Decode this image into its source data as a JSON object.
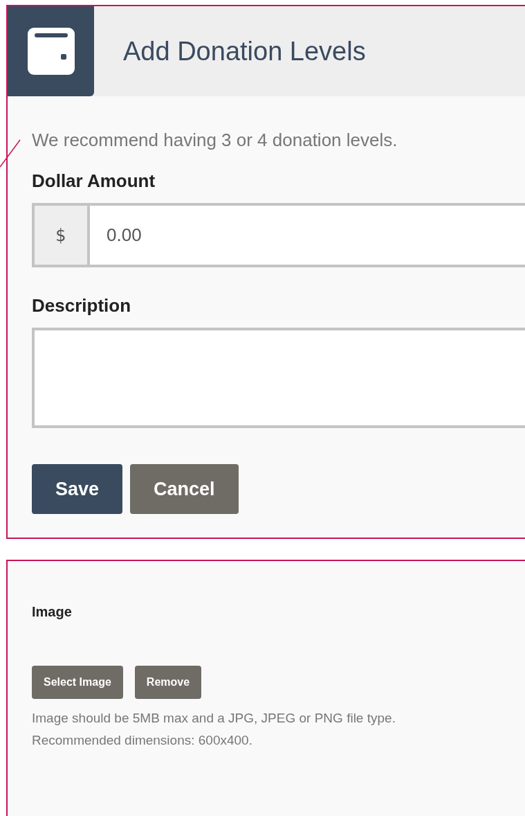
{
  "header": {
    "title": "Add Donation Levels"
  },
  "intro": "We recommend having 3 or 4 donation levels.",
  "amount": {
    "label": "Dollar Amount",
    "prefix": "$",
    "value": "0.00"
  },
  "description": {
    "label": "Description"
  },
  "buttons": [
    {
      "label": "Save",
      "kind": "primary"
    },
    {
      "label": "Cancel",
      "kind": "secondary"
    }
  ],
  "image": {
    "label": "Image",
    "buttons": [
      "Select Image",
      "Remove"
    ],
    "help": [
      "Image should be 5MB max and a JPG, JPEG or PNG file type.",
      "Recommended dimensions: 600x400."
    ]
  }
}
